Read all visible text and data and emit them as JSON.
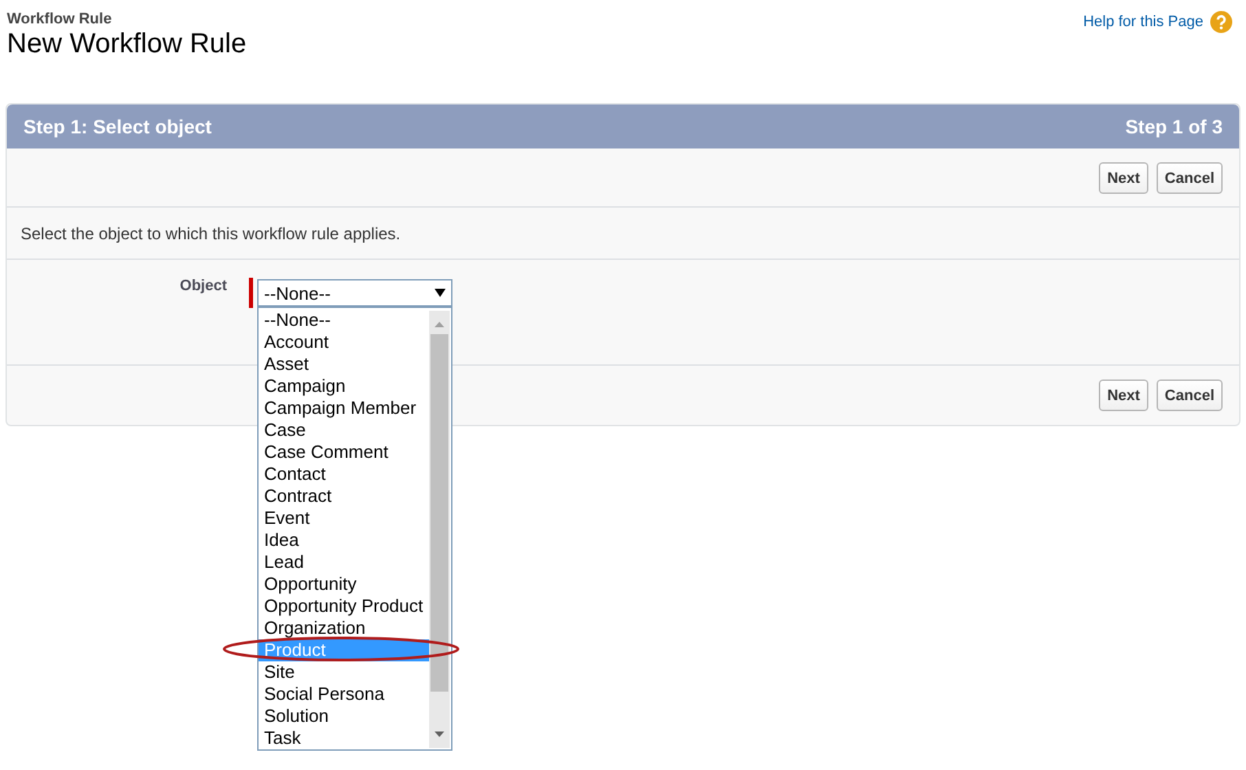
{
  "breadcrumb": "Workflow Rule",
  "title": "New Workflow Rule",
  "help_link": "Help for this Page",
  "wizard": {
    "step_title": "Step 1: Select object",
    "step_counter": "Step 1 of 3",
    "top_buttons": [
      "Next",
      "Cancel"
    ],
    "instruction": "Select the object to which this workflow rule applies.",
    "field": {
      "label": "Object",
      "required": true,
      "value": "--None--",
      "expanded": true,
      "options": [
        {
          "label": "--None--",
          "highlighted": false
        },
        {
          "label": "Account",
          "highlighted": false
        },
        {
          "label": "Asset",
          "highlighted": false
        },
        {
          "label": "Campaign",
          "highlighted": false
        },
        {
          "label": "Campaign Member",
          "highlighted": false
        },
        {
          "label": "Case",
          "highlighted": false
        },
        {
          "label": "Case Comment",
          "highlighted": false
        },
        {
          "label": "Contact",
          "highlighted": false
        },
        {
          "label": "Contract",
          "highlighted": false
        },
        {
          "label": "Event",
          "highlighted": false
        },
        {
          "label": "Idea",
          "highlighted": false
        },
        {
          "label": "Lead",
          "highlighted": false
        },
        {
          "label": "Opportunity",
          "highlighted": false
        },
        {
          "label": "Opportunity Product",
          "highlighted": false
        },
        {
          "label": "Organization",
          "highlighted": false
        },
        {
          "label": "Product",
          "highlighted": true
        },
        {
          "label": "Site",
          "highlighted": false
        },
        {
          "label": "Social Persona",
          "highlighted": false
        },
        {
          "label": "Solution",
          "highlighted": false
        },
        {
          "label": "Task",
          "highlighted": false
        }
      ]
    },
    "bottom_buttons": [
      "Next",
      "Cancel"
    ]
  }
}
